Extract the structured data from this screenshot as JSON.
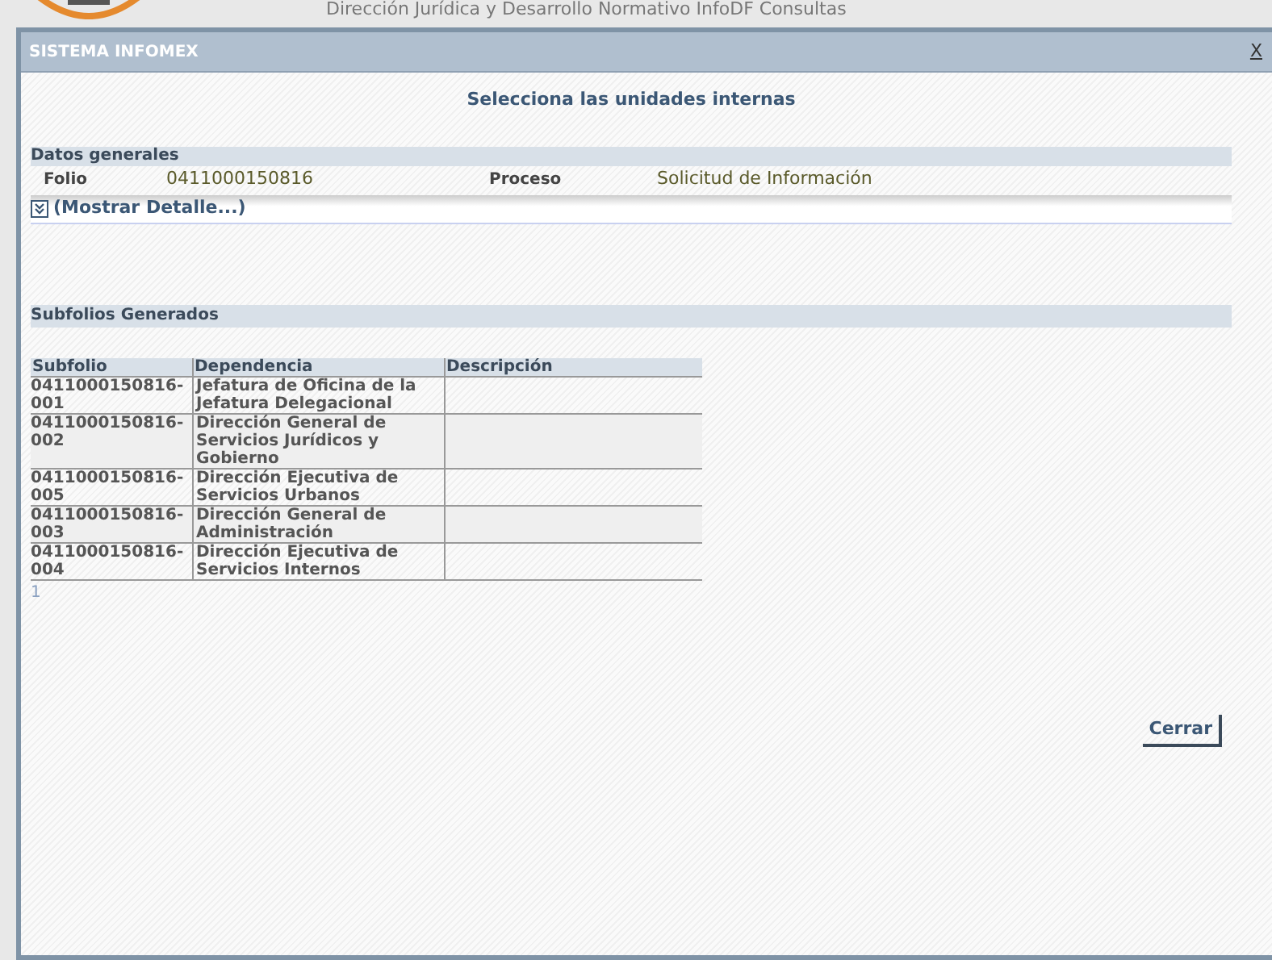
{
  "background_page": {
    "header": "Dirección Jurídica y Desarrollo Normativo InfoDF Consultas"
  },
  "dialog": {
    "title": "SISTEMA INFOMEX",
    "close": "X",
    "heading": "Selecciona las unidades internas"
  },
  "datos_generales": {
    "title": "Datos generales",
    "fields": [
      {
        "label": "Folio",
        "value": "0411000150816"
      },
      {
        "label": "Proceso",
        "value": "Solicitud de Información"
      }
    ],
    "details_link": "(Mostrar Detalle...)",
    "expanded": false
  },
  "subfolios": {
    "title": "Subfolios Generados",
    "columns": [
      "Subfolio",
      "Dependencia",
      "Descripción"
    ],
    "rows": [
      {
        "subfolio": "0411000150816-001",
        "dependencia": "Jefatura de Oficina de la Jefatura Delegacional"
      },
      {
        "subfolio": "0411000150816-002",
        "dependencia": "Dirección General de Servicios Jurídicos y Gobierno"
      },
      {
        "subfolio": "0411000150816-005",
        "dependencia": "Dirección Ejecutiva de Servicios Urbanos"
      },
      {
        "subfolio": "0411000150816-003",
        "dependencia": "Dirección General de Administración"
      },
      {
        "subfolio": "0411000150816-004",
        "dependencia": "Dirección Ejecutiva de Servicios Internos"
      }
    ],
    "pages": [
      {
        "label": "1",
        "selected": true
      }
    ]
  },
  "buttons": [
    {
      "label": "Cerrar"
    }
  ]
}
